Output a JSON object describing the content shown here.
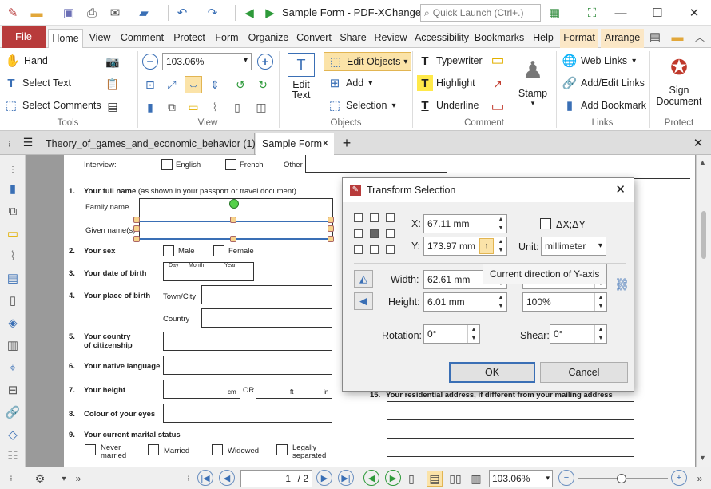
{
  "window": {
    "title": "Sample Form - PDF-XChange E..",
    "quick_launch_placeholder": "Quick Launch (Ctrl+.)"
  },
  "menu": {
    "file": "File",
    "tabs": [
      "Home",
      "View",
      "Comment",
      "Protect",
      "Form",
      "Organize",
      "Convert",
      "Share",
      "Review",
      "Accessibility",
      "Bookmarks",
      "Help",
      "Format",
      "Arrange"
    ]
  },
  "ribbon": {
    "tools": {
      "hand": "Hand",
      "select_text": "Select Text",
      "select_comments": "Select Comments",
      "label": "Tools"
    },
    "view": {
      "zoom": "103.06%",
      "label": "View"
    },
    "objects": {
      "edit_text": "Edit\nText",
      "edit_text_l1": "Edit",
      "edit_text_l2": "Text",
      "edit_objects": "Edit Objects",
      "add": "Add",
      "selection": "Selection",
      "label": "Objects"
    },
    "comment": {
      "typewriter": "Typewriter",
      "highlight": "Highlight",
      "underline": "Underline",
      "stamp": "Stamp",
      "label": "Comment"
    },
    "links": {
      "web_links": "Web Links",
      "add_edit_links": "Add/Edit Links",
      "add_bookmark": "Add Bookmark",
      "label": "Links"
    },
    "protect": {
      "sign_l1": "Sign",
      "sign_l2": "Document",
      "label": "Protect"
    }
  },
  "doc_tabs": [
    "Theory_of_games_and_economic_behavior (1)",
    "Sample Form"
  ],
  "form": {
    "interview": "Interview:",
    "english": "English",
    "french": "French",
    "other": "Other",
    "q1": "1.",
    "q1_label": "Your full name",
    "q1_note": "(as shown in your passport or travel document)",
    "family_name": "Family name",
    "given_names": "Given name(s)",
    "q2": "2.",
    "q2_label": "Your sex",
    "male": "Male",
    "female": "Female",
    "q3": "3.",
    "q3_label": "Your date of birth",
    "day": "Day",
    "month": "Month",
    "year": "Year",
    "q4": "4.",
    "q4_label": "Your place of birth",
    "town_city": "Town/City",
    "country": "Country",
    "q5": "5.",
    "q5_label_1": "Your country",
    "q5_label_2": "of citizenship",
    "q6": "6.",
    "q6_label": "Your native language",
    "q7": "7.",
    "q7_label": "Your height",
    "cm": "cm",
    "or": "OR",
    "ft": "ft",
    "in": "in",
    "q8": "8.",
    "q8_label": "Colour of your eyes",
    "q9": "9.",
    "q9_label": "Your current marital status",
    "never_married_1": "Never",
    "never_married_2": "married",
    "married": "Married",
    "widowed": "Widowed",
    "legally_1": "Legally",
    "legally_2": "separated",
    "q15": "15.",
    "q15_label": "Your residential address, if different from your mailing address"
  },
  "dialog": {
    "title": "Transform Selection",
    "x_label": "X:",
    "x_value": "67.11 mm",
    "y_label": "Y:",
    "y_value": "173.97 mm",
    "delta_label": "ΔX;ΔY",
    "unit_label": "Unit:",
    "unit_value": "millimeter",
    "width_label": "Width:",
    "width_value": "62.61 mm",
    "height_label": "Height:",
    "height_value": "6.01 mm",
    "height_pct": "100%",
    "rotation_label": "Rotation:",
    "rotation_value": "0°",
    "shear_label": "Shear:",
    "shear_value": "0°",
    "ok": "OK",
    "cancel": "Cancel",
    "tooltip": "Current direction of Y-axis"
  },
  "status": {
    "page": "1",
    "page_total": "/ 2",
    "zoom": "103.06%"
  },
  "colors": {
    "file_tab": "#b83b3b",
    "context_tabs": "#fbe7c6",
    "accent_blue": "#3a6fb5",
    "selection_orange": "#f7d28a"
  }
}
